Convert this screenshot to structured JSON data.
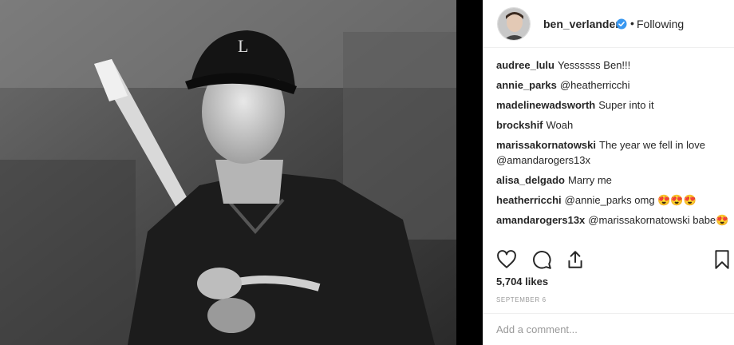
{
  "post": {
    "username": "ben_verlander",
    "separator": "•",
    "follow_status": "Following",
    "likes": "5,704 likes",
    "date": "SEPTEMBER 6"
  },
  "comments": [
    {
      "user": "audree_lulu",
      "text": "Yessssss Ben!!!"
    },
    {
      "user": "annie_parks",
      "text": "@heatherricchi"
    },
    {
      "user": "madelinewadsworth",
      "text": "Super into it"
    },
    {
      "user": "brockshif",
      "text": "Woah"
    },
    {
      "user": "marissakornatowski",
      "text": "The year we fell in love @amandarogers13x"
    },
    {
      "user": "alisa_delgado",
      "text": "Marry me"
    },
    {
      "user": "heatherricchi",
      "text": "@annie_parks omg 😍😍😍"
    },
    {
      "user": "amandarogers13x",
      "text": "@marissakornatowski babe😍"
    }
  ],
  "comment_box": {
    "placeholder": "Add a comment..."
  },
  "icons": {
    "like": "heart-icon",
    "comment": "comment-bubble-icon",
    "share": "share-icon",
    "save": "bookmark-icon",
    "verified": "verified-badge-icon"
  },
  "colors": {
    "verified": "#3897f0",
    "text": "#262626",
    "muted": "#999999"
  }
}
